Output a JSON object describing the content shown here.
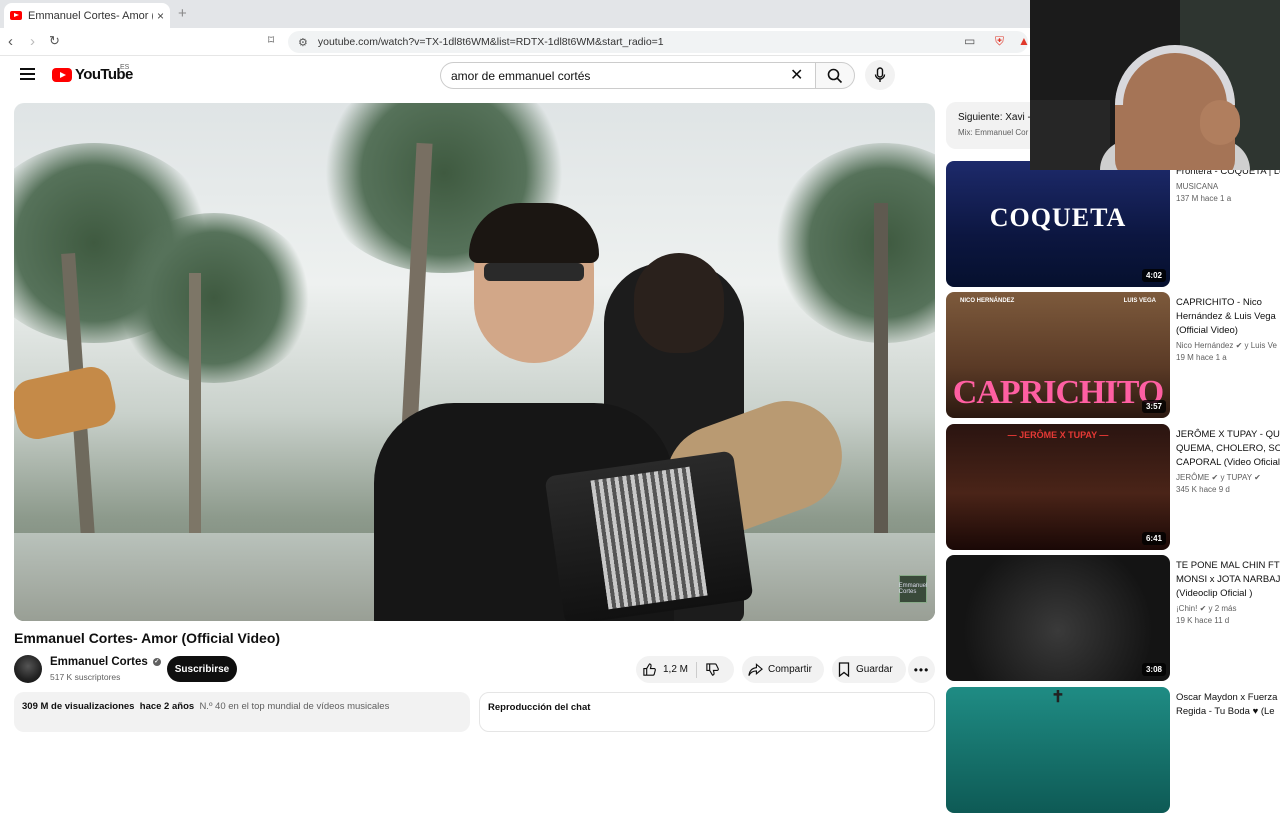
{
  "browser": {
    "tab_title": "Emmanuel Cortes- Amor (Official Video)",
    "tab_close": "×",
    "new_tab": "+",
    "url": "youtube.com/watch?v=TX-1dl8t6WM&list=RDTX-1dl8t6WM&start_radio=1"
  },
  "youtube": {
    "logo_text": "YouTube",
    "region": "ES",
    "search_value": "amor de emmanuel cortés"
  },
  "video": {
    "title": "Emmanuel Cortes- Amor (Official Video)",
    "channel": "Emmanuel Cortes",
    "subscribers": "517 K suscriptores",
    "subscribe_label": "Suscribirse",
    "likes": "1,2 M",
    "share_label": "Compartir",
    "save_label": "Guardar",
    "watermark": "Emmanuel Cortes"
  },
  "description": {
    "views": "309 M de visualizaciones",
    "date": "hace 2 años",
    "tag": "N.º 40 en el top mundial de vídeos musicales"
  },
  "chat": {
    "label": "Reproducción del chat"
  },
  "next": {
    "label": "Siguiente: Xavi -",
    "sub": "Mix: Emmanuel Cor"
  },
  "recommendations": [
    {
      "thumb_text": "COQUETA",
      "duration": "4:02",
      "title_lines": [
        "Frontera - COQUETA | Le"
      ],
      "channel": "MUSICANA",
      "meta": "137 M   hace 1 a"
    },
    {
      "thumb_text": "CAPRICHITO",
      "thumb_left": "NICO HERNÁNDEZ",
      "thumb_right": "LUIS VEGA",
      "duration": "3:57",
      "title_lines": [
        "CAPRICHITO - Nico",
        "Hernández & Luis Vega",
        "(Official Video)"
      ],
      "channel": "Nico Hernández ✔ y Luis Ve",
      "meta": "19 M   hace 1 a"
    },
    {
      "thumb_text": "— JERÔME X TUPAY —",
      "duration": "6:41",
      "title_lines": [
        "JERÔME X TUPAY - QUE",
        "QUEMA, CHOLERO, SOY",
        "CAPORAL (Video Oficial"
      ],
      "channel": "JERÔME ✔ y TUPAY ✔",
      "meta": "345 K   hace 9 d"
    },
    {
      "thumb_text": "",
      "duration": "3:08",
      "title_lines": [
        "TE PONE MAL CHIN FT",
        "MONSI x JOTA NARBAJ",
        "(Videoclip Oficial )"
      ],
      "channel": "¡Chin! ✔ y 2 más",
      "meta": "19 K   hace 11 d"
    },
    {
      "thumb_text": "",
      "duration": "",
      "title_lines": [
        "Oscar Maydon x Fuerza",
        "Regida - Tu Boda ♥ (Le"
      ],
      "channel": "",
      "meta": ""
    }
  ]
}
